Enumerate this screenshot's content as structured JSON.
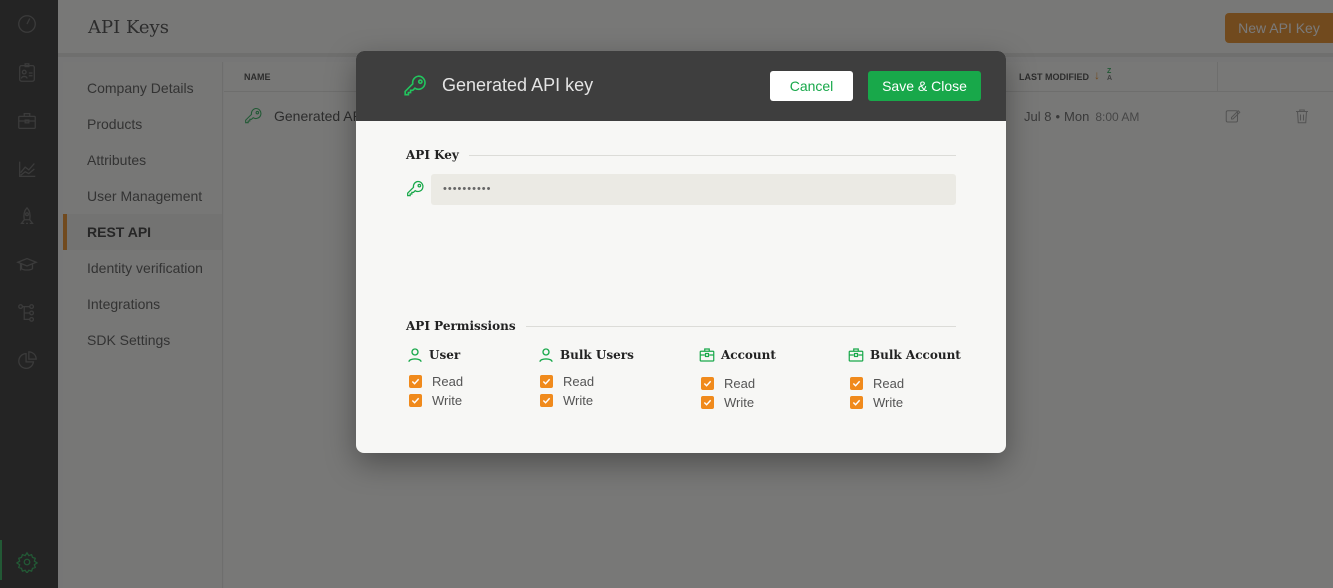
{
  "rail": {
    "icons": [
      "speedometer-icon",
      "contact-card-icon",
      "briefcase-icon",
      "chart-icon",
      "rocket-icon",
      "graduation-cap-icon",
      "hierarchy-icon",
      "pie-chart-icon"
    ],
    "settings_icon": "gear-icon"
  },
  "header": {
    "title": "API Keys",
    "new_button": "New API Key"
  },
  "subnav": {
    "items": [
      {
        "label": "Company Details"
      },
      {
        "label": "Products"
      },
      {
        "label": "Attributes"
      },
      {
        "label": "User Management"
      },
      {
        "label": "REST API",
        "active": true
      },
      {
        "label": "Identity verification"
      },
      {
        "label": "Integrations"
      },
      {
        "label": "SDK Settings"
      }
    ]
  },
  "table": {
    "columns": {
      "name": "Name",
      "last_modified": "Last Modified"
    },
    "sort": {
      "direction": "desc",
      "z": "Z",
      "a": "A"
    },
    "rows": [
      {
        "name": "Generated API key",
        "name_visible": "Generated AP",
        "date": "Jul 8",
        "day": "Mon",
        "time": "8:00 AM"
      }
    ]
  },
  "modal": {
    "title": "Generated API key",
    "cancel": "Cancel",
    "save": "Save & Close",
    "api_key": {
      "label": "API Key",
      "value": "••••••••••"
    },
    "permissions": {
      "label": "API Permissions",
      "groups": [
        {
          "name": "User",
          "icon": "user-icon",
          "read": "Read",
          "write": "Write",
          "read_checked": true,
          "write_checked": true
        },
        {
          "name": "Bulk Users",
          "icon": "user-icon",
          "read": "Read",
          "write": "Write",
          "read_checked": true,
          "write_checked": true
        },
        {
          "name": "Account",
          "icon": "briefcase-icon",
          "read": "Read",
          "write": "Write",
          "read_checked": true,
          "write_checked": true
        },
        {
          "name": "Bulk Account",
          "icon": "briefcase-icon",
          "read": "Read",
          "write": "Write",
          "read_checked": true,
          "write_checked": true
        }
      ]
    }
  },
  "colors": {
    "accent_orange": "#e6800f",
    "accent_green": "#18a84a",
    "modal_header": "#3e3e3e",
    "rail": "#1f1f1f"
  }
}
